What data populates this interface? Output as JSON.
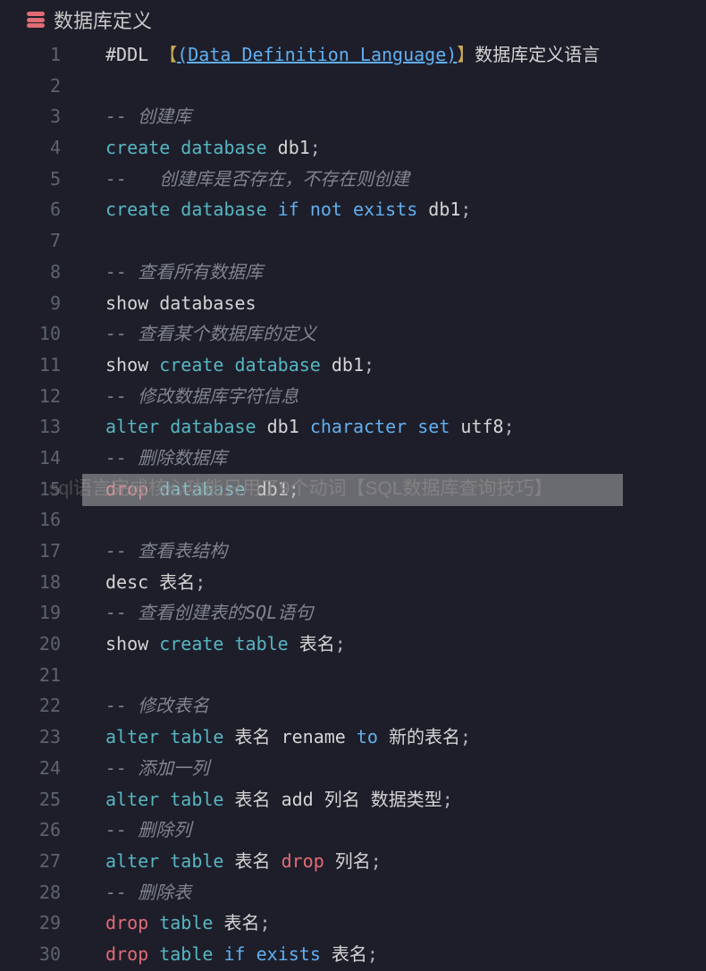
{
  "header": {
    "title": "数据库定义"
  },
  "overlay": {
    "caption": "sql语言完成核心功能只用了9个动词【SQL数据库查询技巧】"
  },
  "code": {
    "lines": [
      {
        "n": "1",
        "seg": [
          {
            "t": "#DDL ",
            "c": "c-text"
          },
          {
            "t": "【",
            "c": "c-box"
          },
          {
            "t": "(Data Definition Language)",
            "c": "c-link"
          },
          {
            "t": "】",
            "c": "c-box"
          },
          {
            "t": "数据库定义语言",
            "c": "c-text"
          }
        ]
      },
      {
        "n": "2",
        "seg": []
      },
      {
        "n": "3",
        "seg": [
          {
            "t": "-- ",
            "c": "c-comment"
          },
          {
            "t": "创建库",
            "c": "c-comment"
          }
        ]
      },
      {
        "n": "4",
        "seg": [
          {
            "t": "create",
            "c": "c-kw"
          },
          {
            "t": " ",
            "c": ""
          },
          {
            "t": "database",
            "c": "c-kw"
          },
          {
            "t": " db1",
            "c": "c-text"
          },
          {
            "t": ";",
            "c": "c-punc"
          }
        ]
      },
      {
        "n": "5",
        "seg": [
          {
            "t": "--   创建库是否存在，不存在则创建",
            "c": "c-comment"
          }
        ]
      },
      {
        "n": "6",
        "seg": [
          {
            "t": "create",
            "c": "c-kw"
          },
          {
            "t": " ",
            "c": ""
          },
          {
            "t": "database",
            "c": "c-kw"
          },
          {
            "t": " ",
            "c": ""
          },
          {
            "t": "if",
            "c": "c-kw2"
          },
          {
            "t": " ",
            "c": ""
          },
          {
            "t": "not",
            "c": "c-kw2"
          },
          {
            "t": " ",
            "c": ""
          },
          {
            "t": "exists",
            "c": "c-kw2"
          },
          {
            "t": " db1",
            "c": "c-text"
          },
          {
            "t": ";",
            "c": "c-punc"
          }
        ]
      },
      {
        "n": "7",
        "seg": []
      },
      {
        "n": "8",
        "seg": [
          {
            "t": "-- 查看所有数据库",
            "c": "c-comment"
          }
        ]
      },
      {
        "n": "9",
        "seg": [
          {
            "t": "show",
            "c": "c-text"
          },
          {
            "t": " databases",
            "c": "c-text"
          }
        ]
      },
      {
        "n": "10",
        "seg": [
          {
            "t": "-- 查看某个数据库的定义",
            "c": "c-comment"
          }
        ]
      },
      {
        "n": "11",
        "seg": [
          {
            "t": "show ",
            "c": "c-text"
          },
          {
            "t": "create",
            "c": "c-kw"
          },
          {
            "t": " ",
            "c": ""
          },
          {
            "t": "database",
            "c": "c-kw"
          },
          {
            "t": " db1",
            "c": "c-text"
          },
          {
            "t": ";",
            "c": "c-punc"
          }
        ]
      },
      {
        "n": "12",
        "seg": [
          {
            "t": "-- 修改数据库字符信息",
            "c": "c-comment"
          }
        ]
      },
      {
        "n": "13",
        "seg": [
          {
            "t": "alter",
            "c": "c-kw"
          },
          {
            "t": " ",
            "c": ""
          },
          {
            "t": "database",
            "c": "c-kw"
          },
          {
            "t": " db1 ",
            "c": "c-text"
          },
          {
            "t": "character",
            "c": "c-kw2"
          },
          {
            "t": " ",
            "c": ""
          },
          {
            "t": "set",
            "c": "c-kw2"
          },
          {
            "t": " utf8",
            "c": "c-text"
          },
          {
            "t": ";",
            "c": "c-punc"
          }
        ]
      },
      {
        "n": "14",
        "seg": [
          {
            "t": "-- 删除数据库",
            "c": "c-comment"
          }
        ]
      },
      {
        "n": "15",
        "seg": [
          {
            "t": "drop",
            "c": "c-drop"
          },
          {
            "t": " ",
            "c": ""
          },
          {
            "t": "database",
            "c": "c-kw"
          },
          {
            "t": " db1",
            "c": "c-text"
          },
          {
            "t": ";",
            "c": "c-punc"
          }
        ]
      },
      {
        "n": "16",
        "seg": []
      },
      {
        "n": "17",
        "seg": [
          {
            "t": "-- 查看表结构",
            "c": "c-comment"
          }
        ]
      },
      {
        "n": "18",
        "seg": [
          {
            "t": "desc",
            "c": "c-text"
          },
          {
            "t": " 表名",
            "c": "c-text"
          },
          {
            "t": ";",
            "c": "c-punc"
          }
        ]
      },
      {
        "n": "19",
        "seg": [
          {
            "t": "-- 查看创建表的SQL语句",
            "c": "c-comment"
          }
        ]
      },
      {
        "n": "20",
        "seg": [
          {
            "t": "show ",
            "c": "c-text"
          },
          {
            "t": "create",
            "c": "c-kw"
          },
          {
            "t": " ",
            "c": ""
          },
          {
            "t": "table",
            "c": "c-kw"
          },
          {
            "t": " 表名",
            "c": "c-text"
          },
          {
            "t": ";",
            "c": "c-punc"
          }
        ]
      },
      {
        "n": "21",
        "seg": []
      },
      {
        "n": "22",
        "seg": [
          {
            "t": "-- 修改表名",
            "c": "c-comment"
          }
        ]
      },
      {
        "n": "23",
        "seg": [
          {
            "t": "alter",
            "c": "c-kw"
          },
          {
            "t": " ",
            "c": ""
          },
          {
            "t": "table",
            "c": "c-kw"
          },
          {
            "t": " 表名 ",
            "c": "c-text"
          },
          {
            "t": "rename",
            "c": "c-text"
          },
          {
            "t": " ",
            "c": ""
          },
          {
            "t": "to",
            "c": "c-kw2"
          },
          {
            "t": " 新的表名",
            "c": "c-text"
          },
          {
            "t": ";",
            "c": "c-punc"
          }
        ]
      },
      {
        "n": "24",
        "seg": [
          {
            "t": "-- 添加一列",
            "c": "c-comment"
          }
        ]
      },
      {
        "n": "25",
        "seg": [
          {
            "t": "alter",
            "c": "c-kw"
          },
          {
            "t": " ",
            "c": ""
          },
          {
            "t": "table",
            "c": "c-kw"
          },
          {
            "t": " 表名 ",
            "c": "c-text"
          },
          {
            "t": "add",
            "c": "c-text"
          },
          {
            "t": " 列名 数据类型",
            "c": "c-text"
          },
          {
            "t": ";",
            "c": "c-punc"
          }
        ]
      },
      {
        "n": "26",
        "seg": [
          {
            "t": "-- 删除列",
            "c": "c-comment"
          }
        ]
      },
      {
        "n": "27",
        "seg": [
          {
            "t": "alter",
            "c": "c-kw"
          },
          {
            "t": " ",
            "c": ""
          },
          {
            "t": "table",
            "c": "c-kw"
          },
          {
            "t": " 表名 ",
            "c": "c-text"
          },
          {
            "t": "drop",
            "c": "c-drop"
          },
          {
            "t": " 列名",
            "c": "c-text"
          },
          {
            "t": ";",
            "c": "c-punc"
          }
        ]
      },
      {
        "n": "28",
        "seg": [
          {
            "t": "-- 删除表",
            "c": "c-comment"
          }
        ]
      },
      {
        "n": "29",
        "seg": [
          {
            "t": "drop",
            "c": "c-drop"
          },
          {
            "t": " ",
            "c": ""
          },
          {
            "t": "table",
            "c": "c-kw"
          },
          {
            "t": " 表名",
            "c": "c-text"
          },
          {
            "t": ";",
            "c": "c-punc"
          }
        ]
      },
      {
        "n": "30",
        "seg": [
          {
            "t": "drop",
            "c": "c-drop"
          },
          {
            "t": " ",
            "c": ""
          },
          {
            "t": "table",
            "c": "c-kw"
          },
          {
            "t": " ",
            "c": ""
          },
          {
            "t": "if",
            "c": "c-kw2"
          },
          {
            "t": " ",
            "c": ""
          },
          {
            "t": "exists",
            "c": "c-kw2"
          },
          {
            "t": " 表名",
            "c": "c-text"
          },
          {
            "t": ";",
            "c": "c-punc"
          }
        ]
      }
    ]
  }
}
